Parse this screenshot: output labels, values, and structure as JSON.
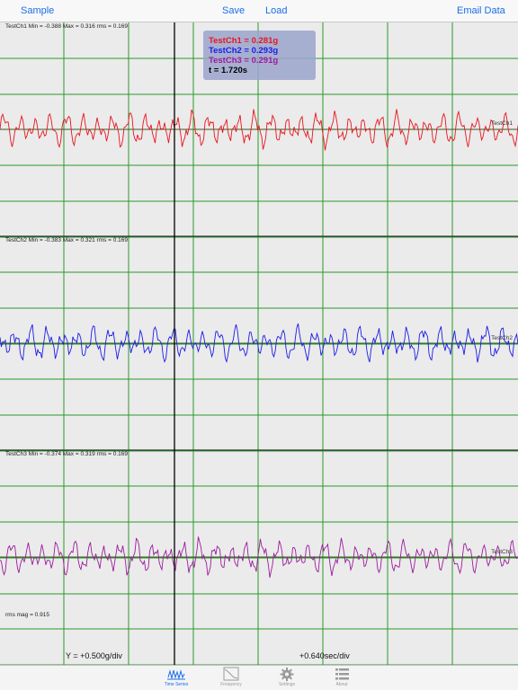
{
  "toolbar": {
    "sample_label": "Sample",
    "save_label": "Save",
    "load_label": "Load",
    "email_label": "Email Data"
  },
  "channels": [
    {
      "name": "TestCh1",
      "stats": "TestCh1 Min = -0.388 Max = 0.316 rms = 0.169",
      "color": "#e8141e"
    },
    {
      "name": "TestCh2",
      "stats": "TestCh2 Min = -0.383 Max = 0.321 rms = 0.169",
      "color": "#1c1ce8"
    },
    {
      "name": "TestCh3",
      "stats": "TestCh3 Min = -0.374 Max = 0.319 rms = 0.169",
      "color": "#9c1c9c"
    }
  ],
  "cursor_readout": {
    "ch1": "TestCh1 = 0.281g",
    "ch2": "TestCh2 = 0.293g",
    "ch3": "TestCh3 = 0.291g",
    "time": "t = 1.720s",
    "time_color": "#000000"
  },
  "rms_mag": "rms mag = 0.915",
  "scale": {
    "y_scale": "Y = +0.500g/div",
    "x_scale": "+0.640sec/div"
  },
  "tabs": [
    {
      "label": "Time Series",
      "icon": "time-series-icon",
      "active": true
    },
    {
      "label": "Frequency",
      "icon": "frequency-icon",
      "active": false
    },
    {
      "label": "Settings",
      "icon": "gear-icon",
      "active": false
    },
    {
      "label": "About",
      "icon": "list-icon",
      "active": false
    }
  ],
  "colors": {
    "accent": "#1a6ee8",
    "grid_vertical": "#2a9a2a",
    "grid_horizontal": "#2a9a2a",
    "plot_background": "#ebebeb",
    "cursor_line": "#000000",
    "baseline": "#3a5a20"
  }
}
